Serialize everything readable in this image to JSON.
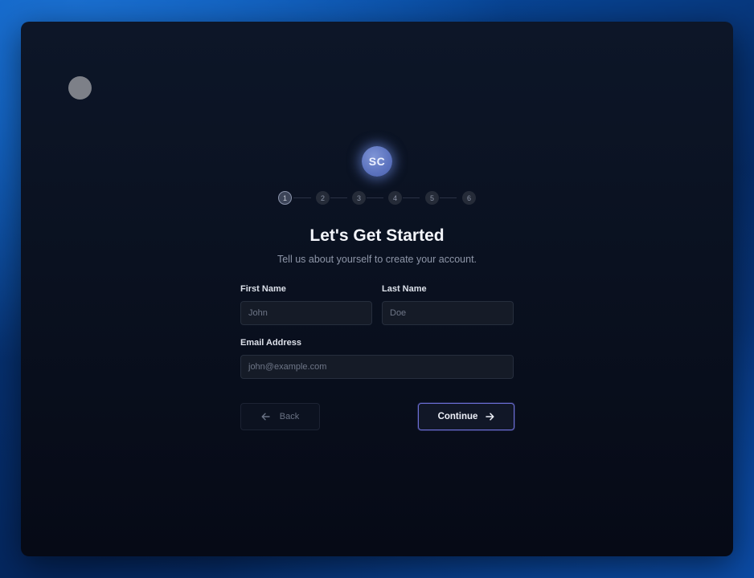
{
  "avatar": {
    "initials": "SC"
  },
  "stepper": {
    "steps": [
      "1",
      "2",
      "3",
      "4",
      "5",
      "6"
    ],
    "current_step": 1
  },
  "heading": {
    "title": "Let's Get Started",
    "subtitle": "Tell us about yourself to create your account."
  },
  "form": {
    "first_name": {
      "label": "First Name",
      "placeholder": "John",
      "value": ""
    },
    "last_name": {
      "label": "Last Name",
      "placeholder": "Doe",
      "value": ""
    },
    "email": {
      "label": "Email Address",
      "placeholder": "john@example.com",
      "value": ""
    }
  },
  "actions": {
    "back_label": "Back",
    "back_icon": "arrow-left-icon",
    "continue_label": "Continue",
    "continue_icon": "arrow-right-icon"
  },
  "colors": {
    "accent_border": "#6c6fd6",
    "avatar_bg": "#5b72be",
    "background_blue": "#0a5cc0"
  }
}
